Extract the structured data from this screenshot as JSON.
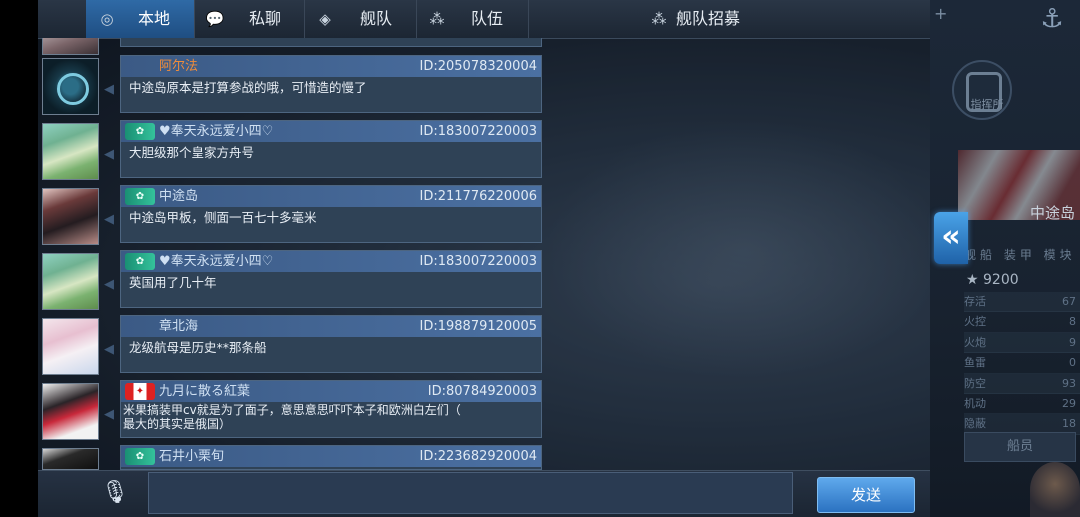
{
  "tabs": [
    {
      "label": "本地",
      "icon": "globe-icon",
      "active": true
    },
    {
      "label": "私聊",
      "icon": "chat-bubble-icon",
      "active": false
    },
    {
      "label": "舰队",
      "icon": "fleet-icon",
      "active": false
    },
    {
      "label": "队伍",
      "icon": "team-icon",
      "active": false
    },
    {
      "label": "舰队招募",
      "icon": "recruit-icon",
      "active": false
    }
  ],
  "messages": [
    {
      "name": "阿尔法",
      "id": "ID:205078320004",
      "text": "中途岛原本是打算参战的哦，可惜造的慢了",
      "badge": "",
      "name_color": "#ef8c3b"
    },
    {
      "name": "♥奉天永远爱小四♡",
      "id": "ID:183007220003",
      "text": "大胆级那个皇家方舟号",
      "badge": "✿"
    },
    {
      "name": "中途岛",
      "id": "ID:211776220006",
      "text": "中途岛甲板，侧面一百七十多毫米",
      "badge": "✿"
    },
    {
      "name": "♥奉天永远爱小四♡",
      "id": "ID:183007220003",
      "text": "英国用了几十年",
      "badge": "✿"
    },
    {
      "name": "章北海",
      "id": "ID:198879120005",
      "text": "龙级航母是历史**那条船",
      "badge": ""
    },
    {
      "name": "九月に散る紅葉",
      "id": "ID:80784920003",
      "text": "米果搞装甲cv就是为了面子，意思意思吓吓本子和欧洲白左们（\n最大的其实是俄国）",
      "badge": "flag"
    },
    {
      "name": "石井小栗旬",
      "id": "ID:223682920004",
      "text": "",
      "badge": "✿"
    }
  ],
  "input": {
    "value": "",
    "placeholder": ""
  },
  "send_label": "发送",
  "side": {
    "ship_name": "中途岛",
    "rating": "9200",
    "tabs_text": "舰船 装甲 模块",
    "stats": [
      {
        "label": "存活",
        "value": "67"
      },
      {
        "label": "火控",
        "value": "8"
      },
      {
        "label": "火炮",
        "value": "9"
      },
      {
        "label": "鱼雷",
        "value": "0"
      },
      {
        "label": "防空",
        "value": "93"
      },
      {
        "label": "机动",
        "value": "29"
      },
      {
        "label": "隐蔽",
        "value": "18"
      }
    ],
    "crew_label": "船员",
    "circle_label": "指挥所"
  },
  "colors": {
    "tab_active": "#2f6aa6",
    "send_button": "#3f8ad6",
    "name_highlight": "#ef8c3b"
  }
}
